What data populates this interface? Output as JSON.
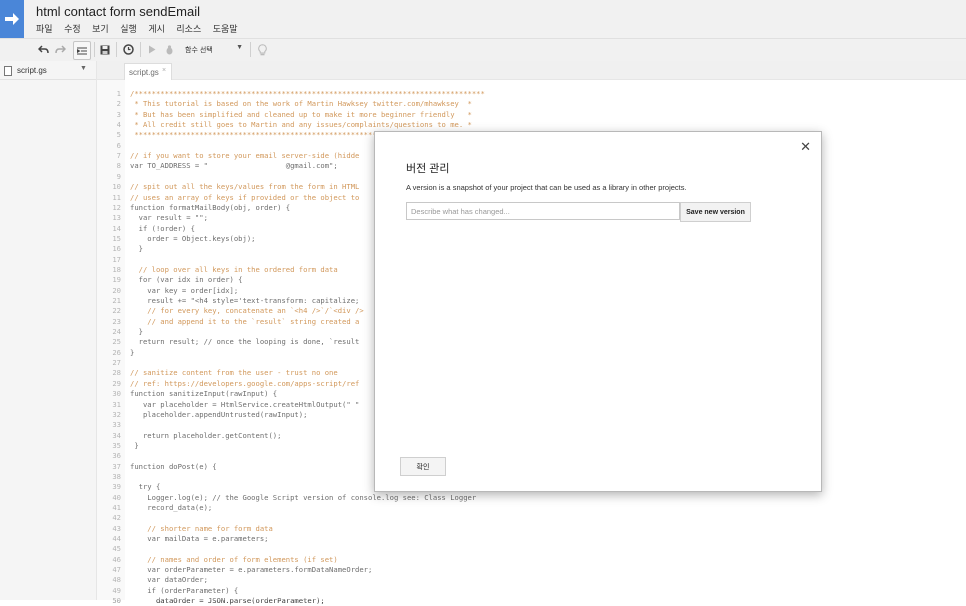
{
  "app": {
    "title": "html contact form sendEmail",
    "menu": [
      "파일",
      "수정",
      "보기",
      "실행",
      "게시",
      "리소스",
      "도움말"
    ]
  },
  "toolbar": {
    "function_select": "함수 선택",
    "icons": [
      "undo-icon",
      "redo-icon",
      "indent-icon",
      "save-icon",
      "clock-icon",
      "run-icon",
      "debug-icon",
      "lightbulb-icon"
    ]
  },
  "sidebar": {
    "files": [
      {
        "name": "script.gs"
      }
    ]
  },
  "editor": {
    "tab": "script.gs",
    "lines": [
      {
        "n": "1",
        "text": "/*********************************************************************************",
        "color": "#c0701b"
      },
      {
        "n": "2",
        "text": " * This tutorial is based on the work of Martin Hawksey twitter.com/mhawksey  *",
        "color": "#c0701b"
      },
      {
        "n": "3",
        "text": " * But has been simplified and cleaned up to make it more beginner friendly   *",
        "color": "#c0701b"
      },
      {
        "n": "4",
        "text": " * All credit still goes to Martin and any issues/complaints/questions to me. *",
        "color": "#c0701b"
      },
      {
        "n": "5",
        "text": " *********************************************************************************/",
        "color": "#c0701b"
      },
      {
        "n": "6",
        "text": "",
        "color": "#333333"
      },
      {
        "n": "7",
        "text": "// if you want to store your email server-side (hidde",
        "color": "#c0701b"
      },
      {
        "n": "8",
        "text": "var TO_ADDRESS = \"                  @gmail.com\";",
        "color": "#333333"
      },
      {
        "n": "9",
        "text": "",
        "color": "#333333"
      },
      {
        "n": "10",
        "text": "// spit out all the keys/values from the form in HTML",
        "color": "#c0701b"
      },
      {
        "n": "11",
        "text": "// uses an array of keys if provided or the object to",
        "color": "#c0701b"
      },
      {
        "n": "12",
        "text": "function formatMailBody(obj, order) {",
        "color": "#333333"
      },
      {
        "n": "13",
        "text": "  var result = \"\";",
        "color": "#333333"
      },
      {
        "n": "14",
        "text": "  if (!order) {",
        "color": "#333333"
      },
      {
        "n": "15",
        "text": "    order = Object.keys(obj);",
        "color": "#333333"
      },
      {
        "n": "16",
        "text": "  }",
        "color": "#333333"
      },
      {
        "n": "17",
        "text": "",
        "color": "#333333"
      },
      {
        "n": "18",
        "text": "  // loop over all keys in the ordered form data",
        "color": "#c0701b"
      },
      {
        "n": "19",
        "text": "  for (var idx in order) {",
        "color": "#333333"
      },
      {
        "n": "20",
        "text": "    var key = order[idx];",
        "color": "#333333"
      },
      {
        "n": "21",
        "text": "    result += \"<h4 style='text-transform: capitalize;",
        "color": "#333333"
      },
      {
        "n": "22",
        "text": "    // for every key, concatenate an `<h4 />`/`<div />",
        "color": "#c0701b"
      },
      {
        "n": "23",
        "text": "    // and append it to the `result` string created a",
        "color": "#c0701b"
      },
      {
        "n": "24",
        "text": "  }",
        "color": "#333333"
      },
      {
        "n": "25",
        "text": "  return result; // once the looping is done, `result",
        "color": "#333333"
      },
      {
        "n": "26",
        "text": "}",
        "color": "#333333"
      },
      {
        "n": "27",
        "text": "",
        "color": "#333333"
      },
      {
        "n": "28",
        "text": "// sanitize content from the user - trust no one",
        "color": "#c0701b"
      },
      {
        "n": "29",
        "text": "// ref: https://developers.google.com/apps-script/ref",
        "color": "#c0701b"
      },
      {
        "n": "30",
        "text": "function sanitizeInput(rawInput) {",
        "color": "#333333"
      },
      {
        "n": "31",
        "text": "   var placeholder = HtmlService.createHtmlOutput(\" \"",
        "color": "#333333"
      },
      {
        "n": "32",
        "text": "   placeholder.appendUntrusted(rawInput);",
        "color": "#333333"
      },
      {
        "n": "33",
        "text": "",
        "color": "#333333"
      },
      {
        "n": "34",
        "text": "   return placeholder.getContent();",
        "color": "#333333"
      },
      {
        "n": "35",
        "text": " }",
        "color": "#333333"
      },
      {
        "n": "36",
        "text": "",
        "color": "#333333"
      },
      {
        "n": "37",
        "text": "function doPost(e) {",
        "color": "#333333"
      },
      {
        "n": "38",
        "text": "",
        "color": "#333333"
      },
      {
        "n": "39",
        "text": "  try {",
        "color": "#333333"
      },
      {
        "n": "40",
        "text": "    Logger.log(e); // the Google Script version of console.log see: Class Logger",
        "color": "#333333"
      },
      {
        "n": "41",
        "text": "    record_data(e);",
        "color": "#333333"
      },
      {
        "n": "42",
        "text": "",
        "color": "#333333"
      },
      {
        "n": "43",
        "text": "    // shorter name for form data",
        "color": "#c0701b"
      },
      {
        "n": "44",
        "text": "    var mailData = e.parameters;",
        "color": "#333333"
      },
      {
        "n": "45",
        "text": "",
        "color": "#333333"
      },
      {
        "n": "46",
        "text": "    // names and order of form elements (if set)",
        "color": "#c0701b"
      },
      {
        "n": "47",
        "text": "    var orderParameter = e.parameters.formDataNameOrder;",
        "color": "#333333"
      },
      {
        "n": "48",
        "text": "    var dataOrder;",
        "color": "#333333"
      },
      {
        "n": "49",
        "text": "    if (orderParameter) {",
        "color": "#333333"
      },
      {
        "n": "50",
        "text": "      dataOrder = JSON.parse(orderParameter);",
        "color": "#333333"
      }
    ]
  },
  "dialog": {
    "title": "버전 관리",
    "description": "A version is a snapshot of your project that can be used as a library in other projects.",
    "input_placeholder": "Describe what has changed...",
    "input_value": "",
    "save_label": "Save new version",
    "ok_label": "확인"
  }
}
